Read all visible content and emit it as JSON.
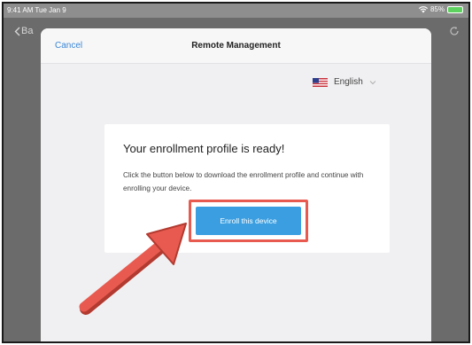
{
  "status_bar": {
    "time": "9:41 AM  Tue Jan 9",
    "battery": "85%"
  },
  "browser": {
    "back_label": "Ba"
  },
  "sheet": {
    "cancel_label": "Cancel",
    "title": "Remote Management",
    "language": "English"
  },
  "card": {
    "heading": "Your enrollment profile is ready!",
    "body": "Click the button below to download the enrollment profile and continue with enrolling your device.",
    "button_label": "Enroll this device"
  },
  "colors": {
    "accent": "#3a86d6",
    "button": "#3a9ee0",
    "highlight": "#e85a4f"
  },
  "icons": [
    "wifi-icon",
    "battery-icon",
    "chevron-left-icon",
    "reload-icon",
    "us-flag-icon",
    "chevron-down-icon",
    "arrow-annotation"
  ]
}
